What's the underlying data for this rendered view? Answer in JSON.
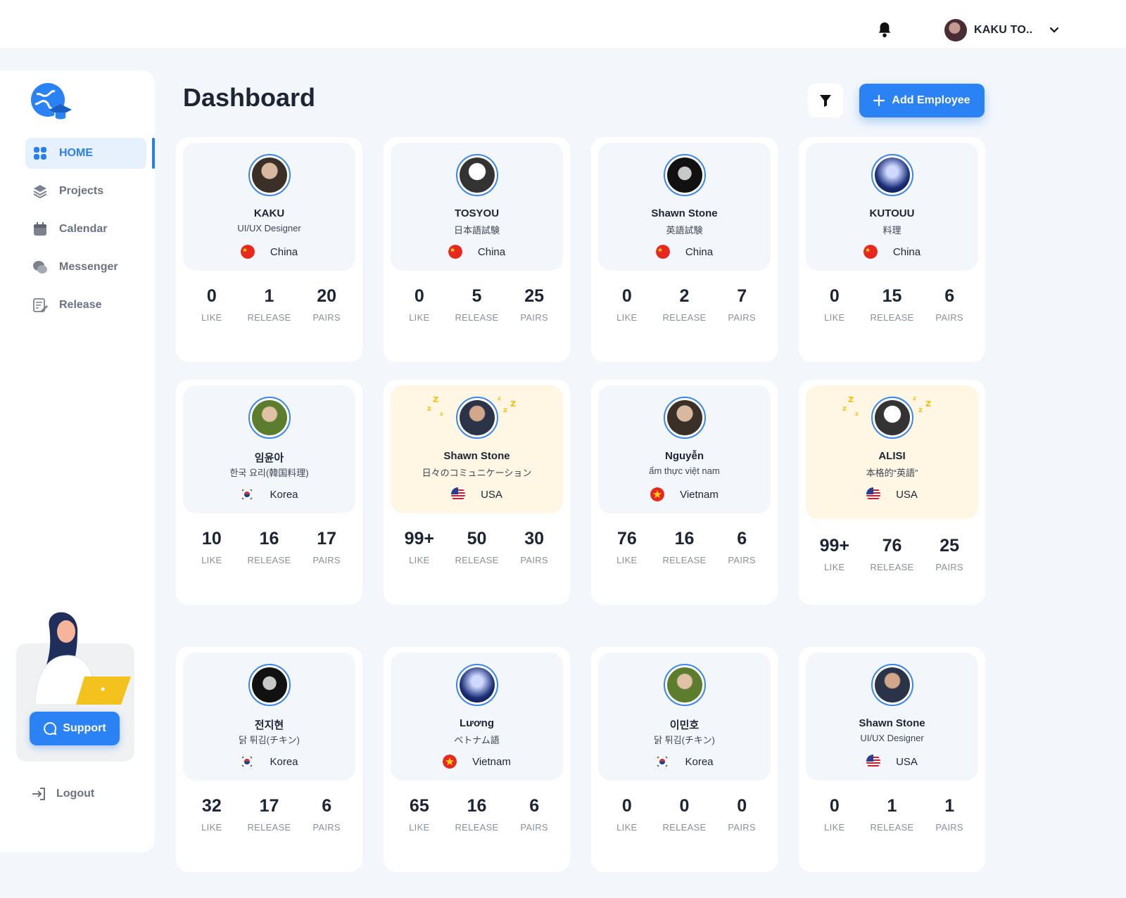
{
  "topbar": {
    "user_name": "KAKU TO..",
    "icons": [
      "bell-icon",
      "chevron-down-icon"
    ]
  },
  "sidebar": {
    "items": [
      {
        "label": "HOME",
        "icon": "grid-icon",
        "active": true
      },
      {
        "label": "Projects",
        "icon": "layers-icon",
        "active": false
      },
      {
        "label": "Calendar",
        "icon": "calendar-icon",
        "active": false
      },
      {
        "label": "Messenger",
        "icon": "chat-icon",
        "active": false
      },
      {
        "label": "Release",
        "icon": "edit-note-icon",
        "active": false
      }
    ],
    "support_label": "Support",
    "logout_label": "Logout"
  },
  "header": {
    "title": "Dashboard",
    "add_label": "Add Employee"
  },
  "colors": {
    "accent": "#2a82f4",
    "active_bg": "#e7f1fd",
    "sleep_bg": "#fff6e3",
    "zzz": "#f4c21d"
  },
  "stat_labels": {
    "like": "LIKE",
    "release": "RELEASE",
    "pairs": "PAIRS"
  },
  "employees": [
    {
      "name": "KAKU",
      "role": "UI/UX Designer",
      "country": "China",
      "flag": "cn",
      "like": "0",
      "release": "1",
      "pairs": "20",
      "sleeping": false
    },
    {
      "name": "TOSYOU",
      "role": "日本語試験",
      "country": "China",
      "flag": "cn",
      "like": "0",
      "release": "5",
      "pairs": "25",
      "sleeping": false
    },
    {
      "name": "Shawn Stone",
      "role": "英語試験",
      "country": "China",
      "flag": "cn",
      "like": "0",
      "release": "2",
      "pairs": "7",
      "sleeping": false
    },
    {
      "name": "KUTOUU",
      "role": "料理",
      "country": "China",
      "flag": "cn",
      "like": "0",
      "release": "15",
      "pairs": "6",
      "sleeping": false
    },
    {
      "name": "임윤아",
      "role": "한국 요리(韓国料理)",
      "country": "Korea",
      "flag": "kr",
      "like": "10",
      "release": "16",
      "pairs": "17",
      "sleeping": false
    },
    {
      "name": "Shawn Stone",
      "role": "日々のコミュニケーション",
      "country": "USA",
      "flag": "us",
      "like": "99+",
      "release": "50",
      "pairs": "30",
      "sleeping": true
    },
    {
      "name": "Nguyễn",
      "role": "ẩm thực việt nam",
      "country": "Vietnam",
      "flag": "vn",
      "like": "76",
      "release": "16",
      "pairs": "6",
      "sleeping": false
    },
    {
      "name": "ALISI",
      "role": "本格的“英語”",
      "country": "USA",
      "flag": "us",
      "like": "99+",
      "release": "76",
      "pairs": "25",
      "sleeping": true
    },
    {
      "name": "전지현",
      "role": "닭 튀김(チキン)",
      "country": "Korea",
      "flag": "kr",
      "like": "32",
      "release": "17",
      "pairs": "6",
      "sleeping": false
    },
    {
      "name": "Lương",
      "role": "ベトナム語",
      "country": "Vietnam",
      "flag": "vn",
      "like": "65",
      "release": "16",
      "pairs": "6",
      "sleeping": false
    },
    {
      "name": "이민호",
      "role": "닭 튀김(チキン)",
      "country": "Korea",
      "flag": "kr",
      "like": "0",
      "release": "0",
      "pairs": "0",
      "sleeping": false
    },
    {
      "name": "Shawn Stone",
      "role": "UI/UX Designer",
      "country": "USA",
      "flag": "us",
      "like": "0",
      "release": "1",
      "pairs": "1",
      "sleeping": false
    }
  ]
}
